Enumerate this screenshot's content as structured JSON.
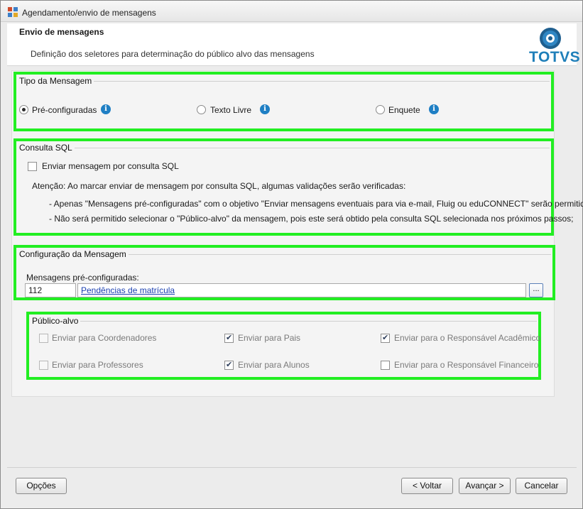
{
  "window": {
    "title": "Agendamento/envio de mensagens"
  },
  "header": {
    "title": "Envio de mensagens",
    "subtitle": "Definição dos seletores para determinação do público alvo das mensagens",
    "logo_text": "TOTVS"
  },
  "tipo": {
    "title": "Tipo da Mensagem",
    "options": [
      {
        "label": "Pré-configuradas",
        "selected": true
      },
      {
        "label": "Texto Livre",
        "selected": false
      },
      {
        "label": "Enquete",
        "selected": false
      }
    ]
  },
  "sql": {
    "title": "Consulta SQL",
    "checkbox_label": "Enviar mensagem por consulta SQL",
    "attention": "Atenção: Ao marcar enviar de mensagem por consulta SQL, algumas validações serão verificadas:",
    "bullet1": "- Apenas \"Mensagens pré-configuradas\" com o objetivo \"Enviar mensagens eventuais para via e-mail, Fluig ou eduCONNECT\" serão permitidas;",
    "bullet2": "- Não será permitido selecionar o \"Público-alvo\" da mensagem, pois este será obtido pela consulta SQL selecionada nos próximos passos;"
  },
  "config": {
    "title": "Configuração da Mensagem",
    "field_label": "Mensagens pré-configuradas:",
    "code": "112",
    "description": "Pendências de matrícula",
    "browse_label": "..."
  },
  "publico": {
    "title": "Público-alvo",
    "items": [
      {
        "label": "Enviar para Coordenadores",
        "checked": false,
        "enabled": false
      },
      {
        "label": "Enviar para Pais",
        "checked": true,
        "enabled": true
      },
      {
        "label": "Enviar para o Responsável Acadêmico",
        "checked": true,
        "enabled": true
      },
      {
        "label": "Enviar para Professores",
        "checked": false,
        "enabled": false
      },
      {
        "label": "Enviar para Alunos",
        "checked": true,
        "enabled": true
      },
      {
        "label": "Enviar para o Responsável Financeiro",
        "checked": false,
        "enabled": true
      }
    ]
  },
  "footer": {
    "options_label": "Opções",
    "back_label": "< Voltar",
    "next_label": "Avançar >",
    "cancel_label": "Cancelar"
  },
  "colors": {
    "highlight": "#22ee22",
    "info": "#1f7fc4",
    "brand": "#1f7fb9"
  }
}
